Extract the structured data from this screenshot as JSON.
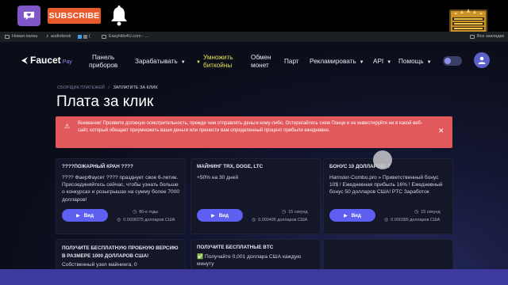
{
  "overlay": {
    "subscribe_label": "SUBSCRIBE",
    "accent_purple": "#8057c8",
    "subscribe_color": "#e85a2b"
  },
  "bookmarks": {
    "items": [
      "Новая папка",
      "audiobook",
      "(",
      "EasyHits4U.com - ..."
    ],
    "right_label": "Все закладки"
  },
  "nav": {
    "logo_text": "Faucet",
    "logo_sub": "Pay",
    "items": [
      {
        "line1": "Панель",
        "line2": "приборов"
      },
      {
        "line1": "Зарабатывать",
        "line2": ""
      },
      {
        "line1": "Умножить",
        "line2": "биткойны"
      },
      {
        "line1": "Обмен",
        "line2": "монет"
      },
      {
        "line1": "Парт",
        "line2": ""
      },
      {
        "line1": "Рекламировать",
        "line2": ""
      },
      {
        "line1": "API",
        "line2": ""
      },
      {
        "line1": "Помощь",
        "line2": ""
      }
    ],
    "highlight_color": "#e6e15a"
  },
  "breadcrumb": {
    "parent": "СБОРЩИК ПЛАТЕЖЕЙ",
    "separator": "/",
    "current": "ЗАПЛАТИТЕ ЗА КЛИК"
  },
  "page": {
    "title": "Плата за клик"
  },
  "warning": {
    "text": "Внимание! Проявите должную осмотрительность, прежде чем отправлять деньги кому-либо. Остерегайтесь схем Понци и не инвестируйте ни в какой веб-сайт, который обещает приумножить ваши деньги или принести вам определенный процент прибыли ежедневно.",
    "color": "#e2595b"
  },
  "cards": [
    {
      "title": "????ПОЖАРНЫЙ КРАН ????",
      "desc": "???? ФаерФаусет ???? празднует свое 6-летие. Присоединяйтесь сейчас, чтобы узнать больше о конкурсах и розыгрышах на сумму более 7000 долларов!",
      "button": "Вид",
      "meta_top": "80-е годы",
      "meta_bottom": "0.0008375 долларов США"
    },
    {
      "title": "МАЙНИНГ TRX, DOGE, LTC",
      "desc": "+50% на 30 дней",
      "button": "Вид",
      "meta_top": "15 секунд",
      "meta_bottom": "0.000495 долларов США"
    },
    {
      "title": "БОНУС 10 ДОЛЛАРОВ! ?",
      "desc": "Hamster-Combo.pro » Приветственный бонус 10$ ! Ежедневная прибыль 16% ! Ежедневный бонус 50 долларов США! PTC Заработок",
      "button": "Вид",
      "meta_top": "15 секунд",
      "meta_bottom": "0.000385 долларов США"
    },
    {
      "title": "ПОЛУЧИТЕ БЕСПЛАТНУЮ ПРОБНУЮ ВЕРСИЮ В РАЗМЕРЕ 1000 ДОЛЛАРОВ США!",
      "desc": "Собственный узел майнинга, 0"
    },
    {
      "title": "ПОЛУЧИТЕ БЕСПЛАТНЫЕ BTC",
      "desc": "✅ Получайте 0,001 доллара США каждую минуту"
    }
  ]
}
